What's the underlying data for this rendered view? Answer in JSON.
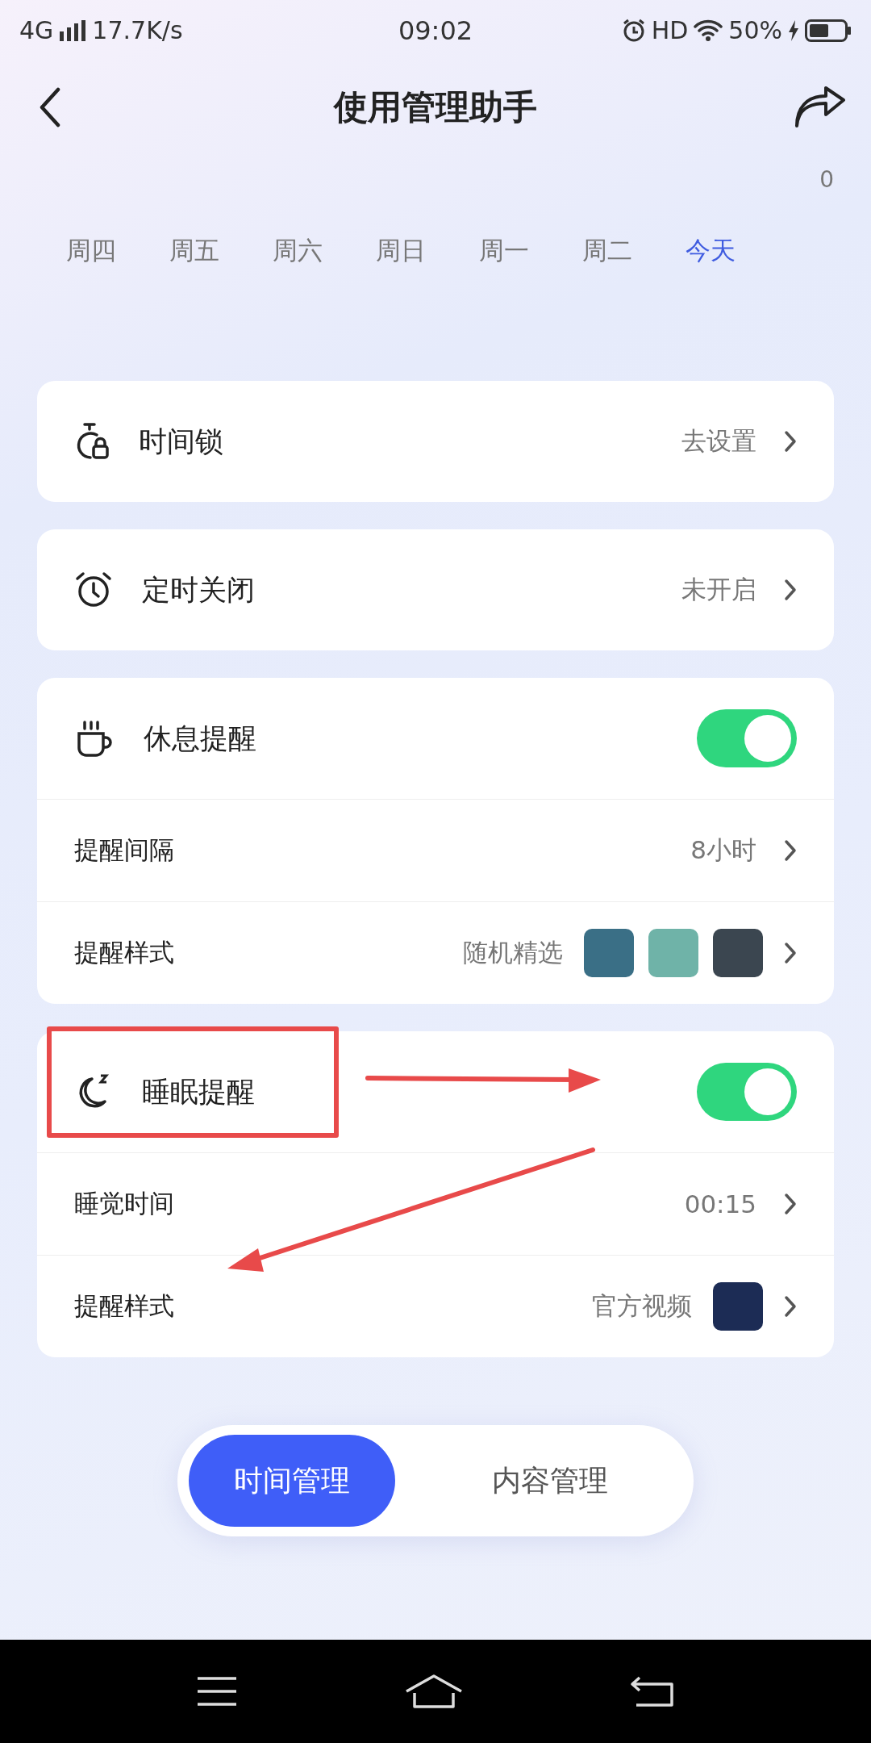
{
  "status_bar": {
    "network": "4G",
    "speed": "17.7K/s",
    "time": "09:02",
    "hd": "HD",
    "battery": "50%"
  },
  "header": {
    "title": "使用管理助手",
    "count": "0"
  },
  "days": [
    {
      "label": "周四",
      "selected": false
    },
    {
      "label": "周五",
      "selected": false
    },
    {
      "label": "周六",
      "selected": false
    },
    {
      "label": "周日",
      "selected": false
    },
    {
      "label": "周一",
      "selected": false
    },
    {
      "label": "周二",
      "selected": false
    },
    {
      "label": "今天",
      "selected": true
    }
  ],
  "cards": [
    {
      "rows": [
        {
          "kind": "link",
          "label": "时间锁",
          "value": "去设置"
        }
      ]
    },
    {
      "rows": [
        {
          "kind": "link",
          "label": "定时关闭",
          "value": "未开启"
        }
      ]
    },
    {
      "rows": [
        {
          "kind": "toggle",
          "label": "休息提醒",
          "on": true
        },
        {
          "kind": "value",
          "label": "提醒间隔",
          "value": "8小时"
        },
        {
          "kind": "gallery",
          "label": "提醒样式",
          "value": "随机精选"
        }
      ]
    },
    {
      "rows": [
        {
          "kind": "toggle",
          "label": "睡眠提醒",
          "on": true
        },
        {
          "kind": "value",
          "label": "睡觉时间",
          "value": "00:15"
        },
        {
          "kind": "video",
          "label": "提醒样式",
          "value": "官方视频"
        }
      ]
    }
  ],
  "segments": [
    {
      "label": "时间管理",
      "selected": true
    },
    {
      "label": "内容管理",
      "selected": false
    }
  ]
}
